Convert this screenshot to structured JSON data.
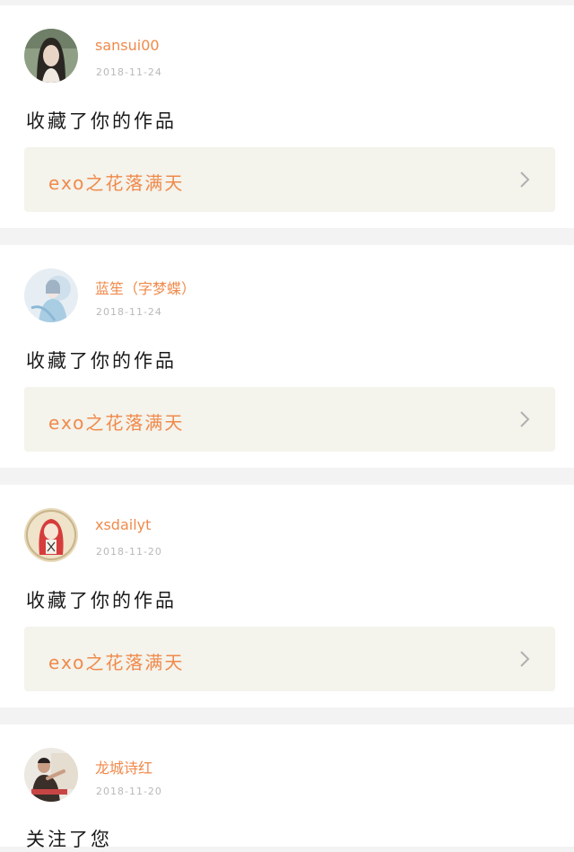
{
  "notifications": [
    {
      "username": "sansui00",
      "date": "2018-11-24",
      "action": "收藏了你的作品",
      "work_title": "exo之花落满天",
      "avatar_icon": "woman-portrait-avatar"
    },
    {
      "username": "蓝笙（字梦蝶）",
      "date": "2018-11-24",
      "action": "收藏了你的作品",
      "work_title": "exo之花落满天",
      "avatar_icon": "blue-costume-avatar"
    },
    {
      "username": "xsdailyt",
      "date": "2018-11-20",
      "action": "收藏了你的作品",
      "work_title": "exo之花落满天",
      "avatar_icon": "red-hair-girl-avatar"
    },
    {
      "username": "龙城诗红",
      "date": "2018-11-20",
      "action": "关注了您",
      "avatar_icon": "man-photo-avatar"
    }
  ],
  "colors": {
    "accent": "#f08a4b",
    "date": "#b8b8b8",
    "link_background": "#f4f3ec",
    "separator": "#f3f3f3"
  }
}
